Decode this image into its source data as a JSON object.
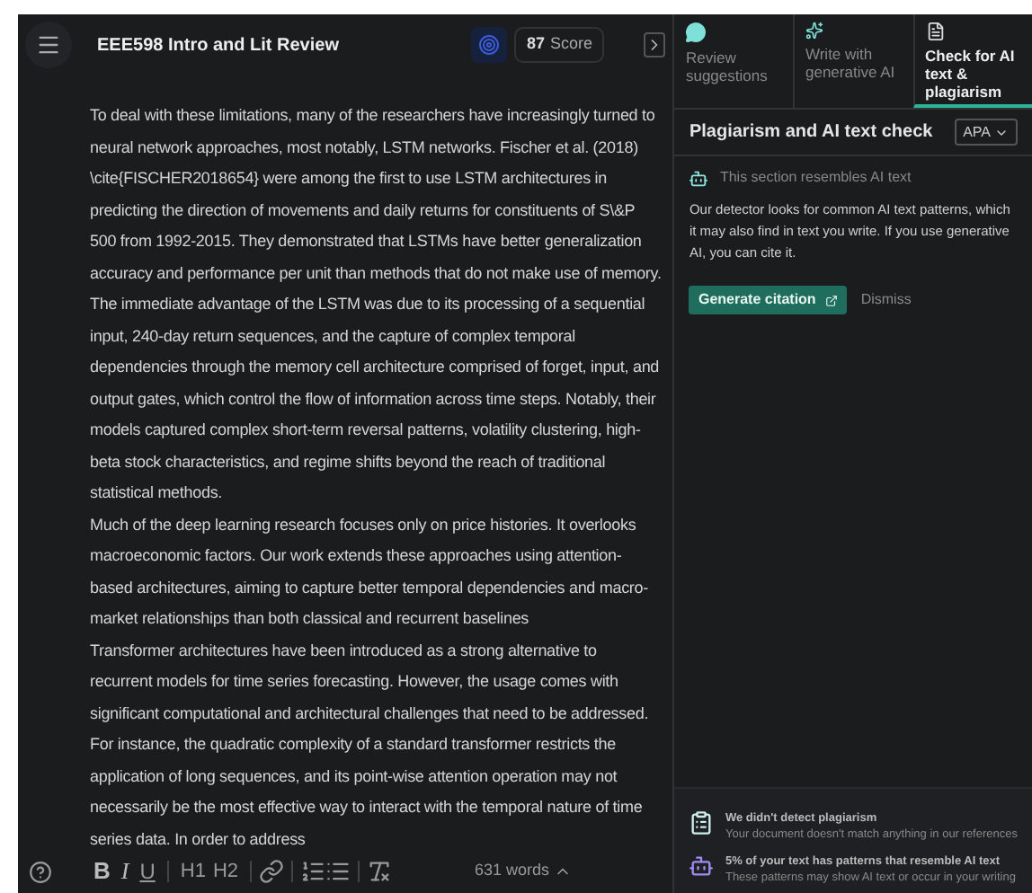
{
  "document": {
    "title": "EEE598 Intro and Lit Review",
    "score": "87",
    "score_label": "Score"
  },
  "paragraphs": [
    "To deal with these limitations, many of the researchers have increasingly turned to neural network approaches, most notably, LSTM networks. Fischer et al. (2018) \\cite{FISCHER2018654} were among the first to use LSTM architectures in predicting the direction of movements and daily returns for constituents of S\\&P 500 from 1992-2015. They demonstrated that LSTMs have better generalization accuracy and performance per unit than methods that do not make use of memory. The immediate advantage of the LSTM was due to its processing of a sequential input, 240-day return sequences, and the capture of complex temporal dependencies through the memory cell architecture comprised of forget, input, and output gates, which control the flow of information across time steps. Notably, their models captured complex short-term reversal patterns, volatility clustering, high-beta stock characteristics, and regime shifts beyond the reach of traditional statistical methods.",
    "Much of the deep learning research focuses only on price histories. It overlooks macroeconomic factors. Our work extends these approaches using attention-based architectures, aiming to capture better temporal dependencies and macro-market relationships than both classical and recurrent baselines",
    "Transformer architectures have been introduced as a strong alternative to recurrent models for time series forecasting. However, the usage comes with significant computational and architectural challenges that need to be addressed. For instance, the quadratic complexity of a standard transformer restricts the application of long sequences, and its point-wise attention operation may not necessarily be the most effective way to interact with the temporal nature of time series data. In order to address"
  ],
  "toolbar": {
    "buttons": [
      {
        "kind": "bold",
        "label": "B"
      },
      {
        "kind": "italic",
        "label": "I"
      },
      {
        "kind": "underline",
        "label": "U"
      },
      {
        "kind": "sep"
      },
      {
        "kind": "h1",
        "label": "H1"
      },
      {
        "kind": "h2",
        "label": "H2"
      },
      {
        "kind": "sep"
      },
      {
        "kind": "link"
      },
      {
        "kind": "sep"
      },
      {
        "kind": "ol"
      },
      {
        "kind": "ul"
      },
      {
        "kind": "sep"
      },
      {
        "kind": "clear"
      }
    ],
    "word_count": "631 words"
  },
  "tabs": [
    {
      "label": "Review suggestions",
      "kind": "review",
      "selected": false
    },
    {
      "label": "Write with generative AI",
      "kind": "write",
      "selected": false
    },
    {
      "label": "Check for AI text & plagiarism",
      "kind": "check",
      "selected": true
    }
  ],
  "panel": {
    "title": "Plagiarism and AI text check",
    "citation_style": "APA",
    "notice": "This section resembles AI text",
    "body": "Our detector looks for common AI text patterns, which it may also find in text you write. If you use generative AI, you can cite it.",
    "primary_button": "Generate citation",
    "secondary_button": "Dismiss"
  },
  "results": [
    {
      "kind": "plagiarism",
      "title": "We didn't detect plagiarism",
      "detail": "Your document doesn't match anything in our references"
    },
    {
      "kind": "ai",
      "title": "5% of your text has patterns that resemble AI text",
      "detail": "These patterns may show AI text or occur in your writing"
    }
  ]
}
